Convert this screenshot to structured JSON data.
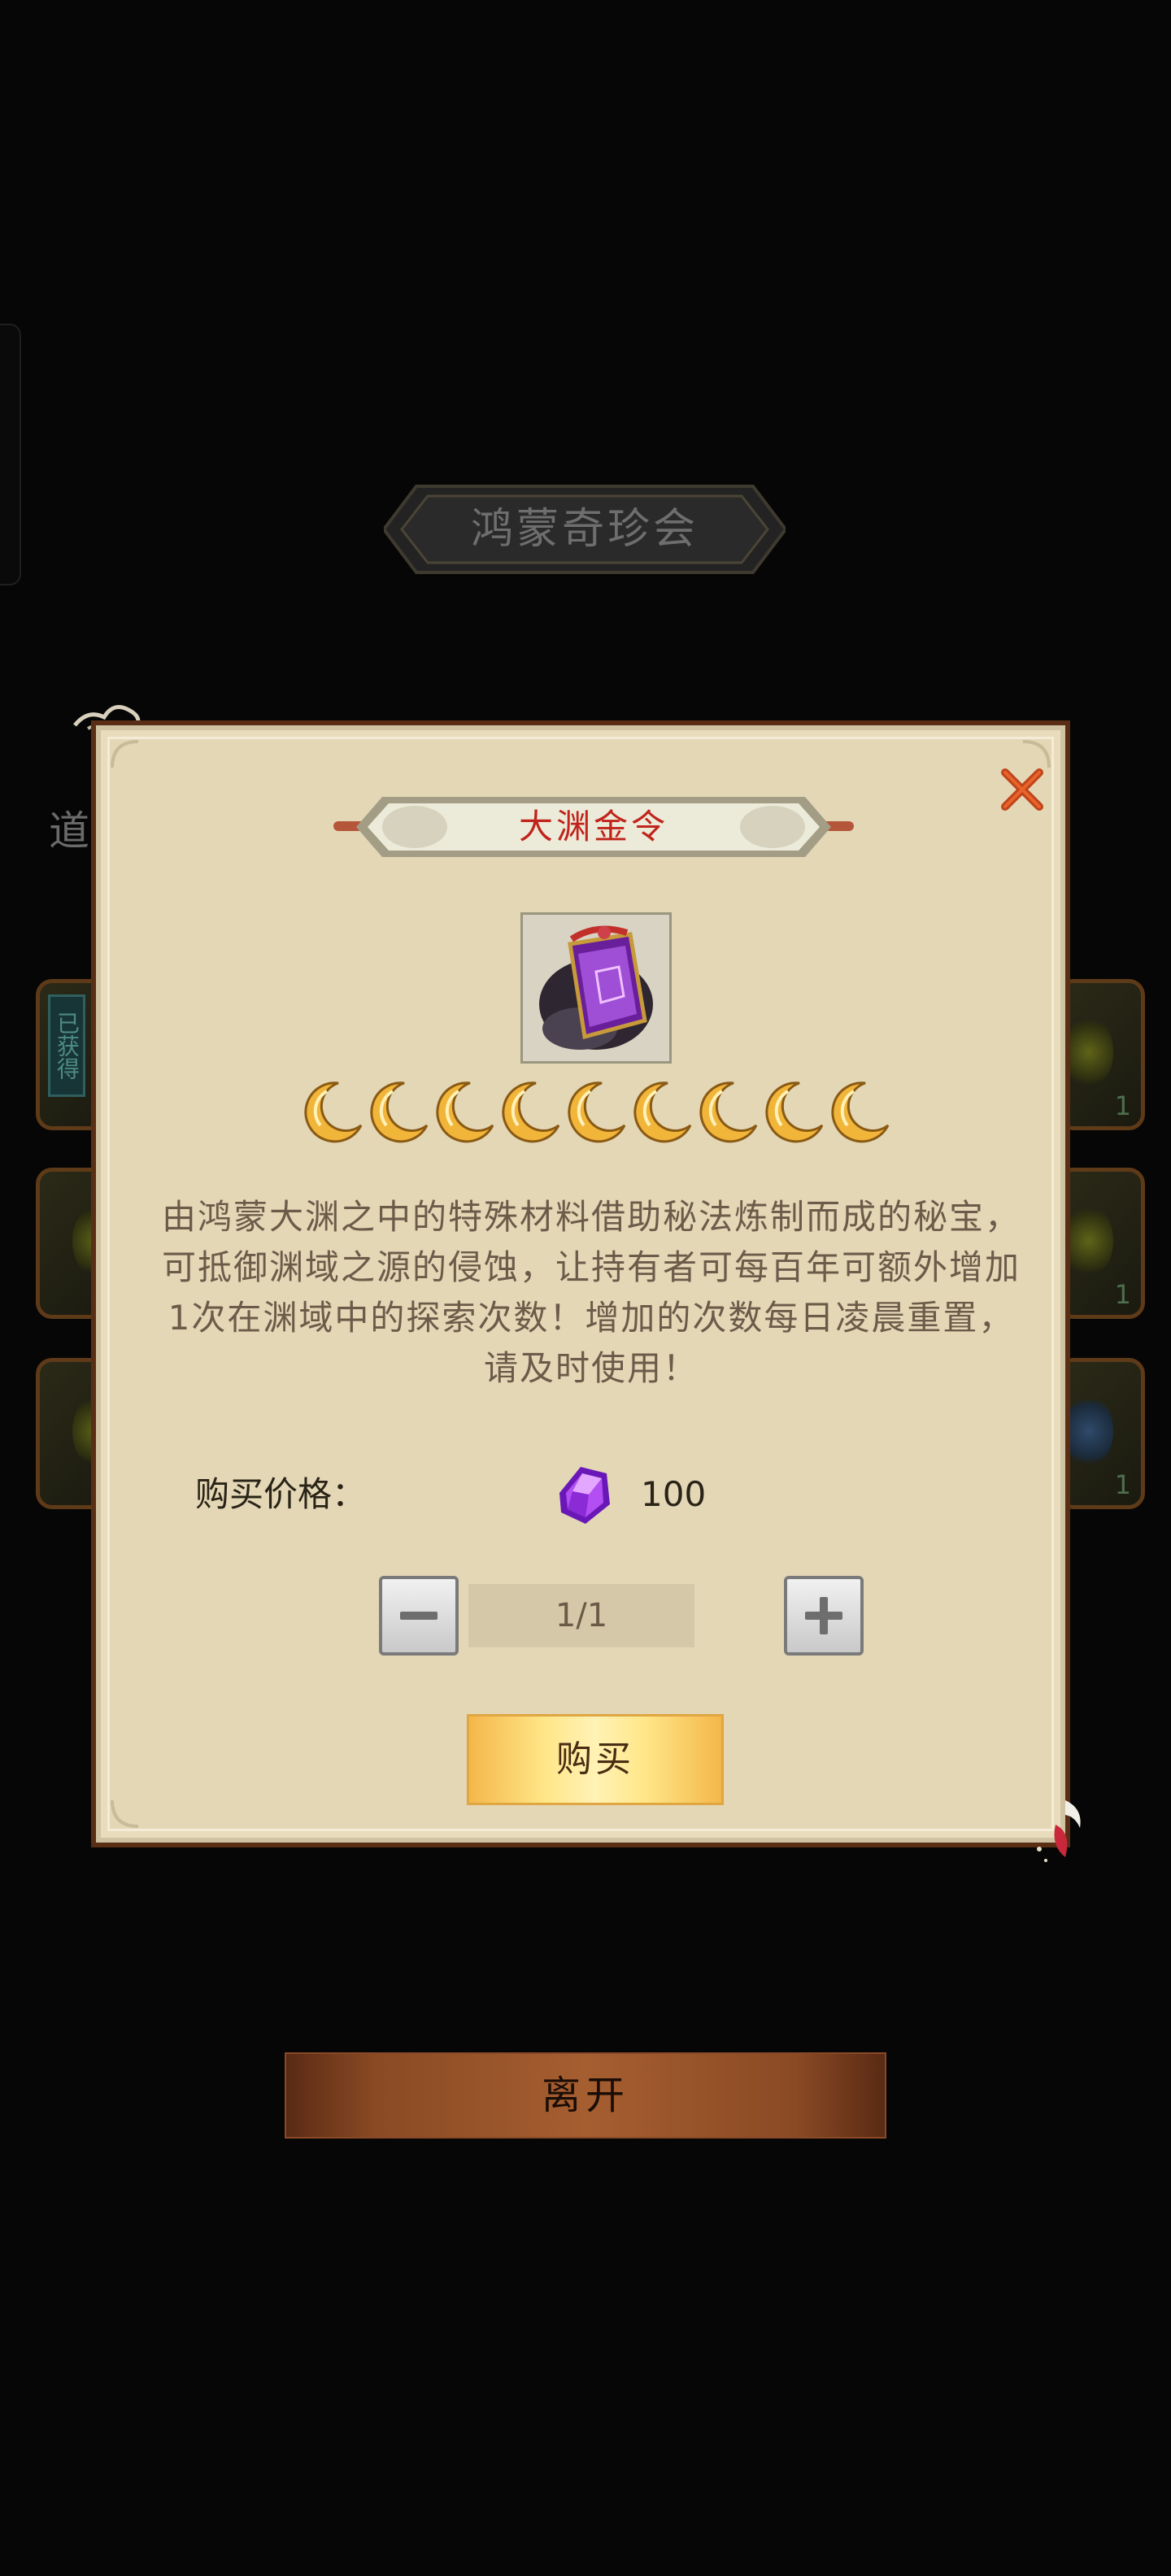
{
  "banner": {
    "title": "鸿蒙奇珍会"
  },
  "background": {
    "partial_label": "道",
    "obtained_tag": "已获得",
    "right_counts": [
      "1",
      "1",
      "1"
    ]
  },
  "dialog": {
    "title": "大渊金令",
    "item_icon": "abyss-token-icon",
    "rating_icon": "moon-icon",
    "rating": 9,
    "description": "由鸿蒙大渊之中的特殊材料借助秘法炼制而成的秘宝，可抵御渊域之源的侵蚀，让持有者可每百年可额外增加1次在渊域中的探索次数！增加的次数每日凌晨重置，请及时使用！",
    "price_label": "购买价格：",
    "price_icon": "purple-gem-icon",
    "price_value": "100",
    "quantity": "1/1",
    "buy_label": "购买",
    "close_icon": "close-icon"
  },
  "footer": {
    "leave_label": "离开"
  },
  "colors": {
    "title_red": "#c0241c",
    "dialog_bg": "#e3d7b6",
    "buy_gold": "#ffe688",
    "leave_bronze": "#a55e30"
  }
}
